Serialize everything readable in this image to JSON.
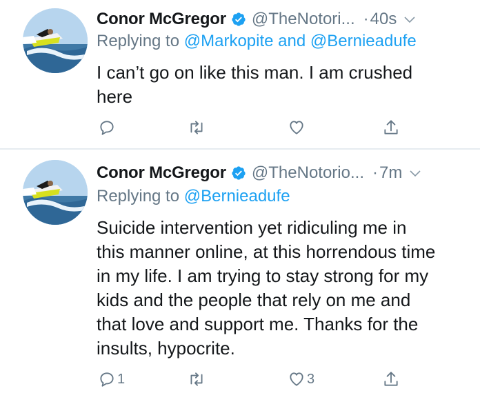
{
  "colors": {
    "text": "#14171a",
    "secondary": "#657786",
    "accent": "#1da1f2",
    "divider": "#e6ecf0"
  },
  "tweets": [
    {
      "author_name": "Conor McGregor",
      "handle": "@TheNotori...",
      "dot": "·",
      "time": "40s",
      "replying_prefix": "Replying to",
      "mentions": [
        "@Markopite",
        "@Bernieadufe"
      ],
      "mention_joiner": "and",
      "lines": [
        "I can’t go on like this man. I am crushed",
        "here"
      ],
      "reply_count": "",
      "retweet_count": "",
      "like_count": "",
      "icons": [
        "reply-icon",
        "retweet-icon",
        "like-icon",
        "share-icon",
        "verified-icon",
        "chevron-down-icon"
      ]
    },
    {
      "author_name": "Conor McGregor",
      "handle": "@TheNotorio...",
      "dot": "·",
      "time": "7m",
      "replying_prefix": "Replying to",
      "mentions": [
        "@Bernieadufe"
      ],
      "lines": [
        "Suicide intervention yet ridiculing me in",
        "this manner online, at this horrendous time",
        "in my life. I am trying to stay strong for my",
        "kids and the people that rely on me and",
        "that love and support me. Thanks for the",
        "insults, hypocrite."
      ],
      "reply_count": "1",
      "retweet_count": "",
      "like_count": "3",
      "icons": [
        "reply-icon",
        "retweet-icon",
        "like-icon",
        "share-icon",
        "verified-icon",
        "chevron-down-icon"
      ]
    }
  ]
}
